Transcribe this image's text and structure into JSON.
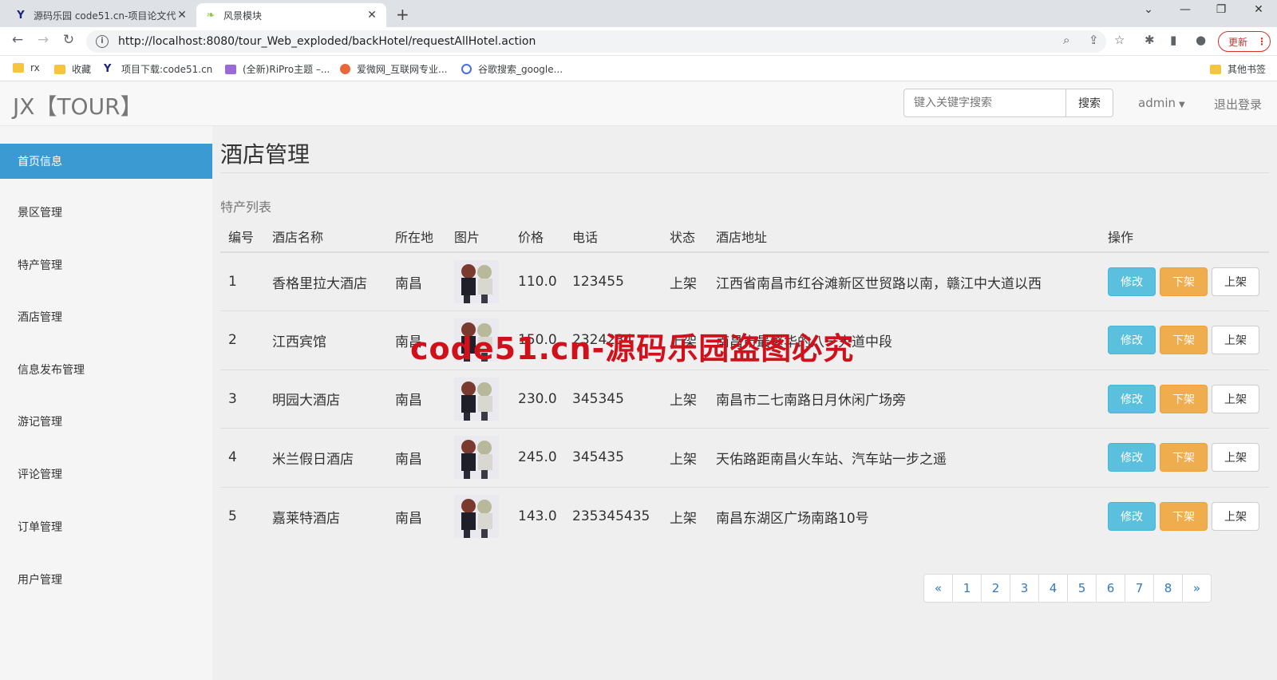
{
  "browser": {
    "tabs": [
      {
        "title": "源码乐园 code51.cn-项目论文代",
        "favicon": "Y"
      },
      {
        "title": "风景模块",
        "favicon": "leaf"
      }
    ],
    "url": "http://localhost:8080/tour_Web_exploded/backHotel/requestAllHotel.action",
    "update_label": "更新",
    "bookmarks": [
      "rx",
      "收藏",
      "项目下载:code51.cn",
      "(全新)RiPro主题 –...",
      "爱微网_互联网专业...",
      "谷歌搜索_google..."
    ],
    "other_bookmarks": "其他书签"
  },
  "header": {
    "brand": "JX【TOUR】",
    "search_placeholder": "键入关键字搜索",
    "search_button": "搜索",
    "user": "admin",
    "logout": "退出登录"
  },
  "sidebar": {
    "items": [
      {
        "label": "首页信息",
        "active": true
      },
      {
        "label": "景区管理"
      },
      {
        "label": "特产管理"
      },
      {
        "label": "酒店管理"
      },
      {
        "label": "信息发布管理"
      },
      {
        "label": "游记管理"
      },
      {
        "label": "评论管理"
      },
      {
        "label": "订单管理"
      },
      {
        "label": "用户管理"
      }
    ]
  },
  "main": {
    "title": "酒店管理",
    "list_caption": "特产列表",
    "columns": [
      "编号",
      "酒店名称",
      "所在地",
      "图片",
      "价格",
      "电话",
      "状态",
      "酒店地址",
      "操作"
    ],
    "rows": [
      {
        "id": "1",
        "name": "香格里拉大酒店",
        "location": "南昌",
        "price": "110.0",
        "phone": "123455",
        "status": "上架",
        "address": "江西省南昌市红谷滩新区世贸路以南，赣江中大道以西"
      },
      {
        "id": "2",
        "name": "江西宾馆",
        "location": "南昌",
        "price": "150.0",
        "phone": "2324234",
        "status": "上架",
        "address": "南昌市最繁华的八一大道中段"
      },
      {
        "id": "3",
        "name": "明园大酒店",
        "location": "南昌",
        "price": "230.0",
        "phone": "345345",
        "status": "上架",
        "address": "南昌市二七南路日月休闲广场旁"
      },
      {
        "id": "4",
        "name": "米兰假日酒店",
        "location": "南昌",
        "price": "245.0",
        "phone": "345435",
        "status": "上架",
        "address": "天佑路距南昌火车站、汽车站一步之遥"
      },
      {
        "id": "5",
        "name": "嘉莱特酒店",
        "location": "南昌",
        "price": "143.0",
        "phone": "235345435",
        "status": "上架",
        "address": "南昌东湖区广场南路10号"
      }
    ],
    "actions": {
      "edit": "修改",
      "down": "下架",
      "up": "上架"
    },
    "pagination": [
      "«",
      "1",
      "2",
      "3",
      "4",
      "5",
      "6",
      "7",
      "8",
      "»"
    ]
  },
  "watermark": "code51.cn-源码乐园盗图必究",
  "colors": {
    "sidebar_active": "#3c9ad3",
    "price": "#c9302c",
    "edit": "#5bc0de",
    "down": "#f0ad4e",
    "link": "#337ab7"
  }
}
